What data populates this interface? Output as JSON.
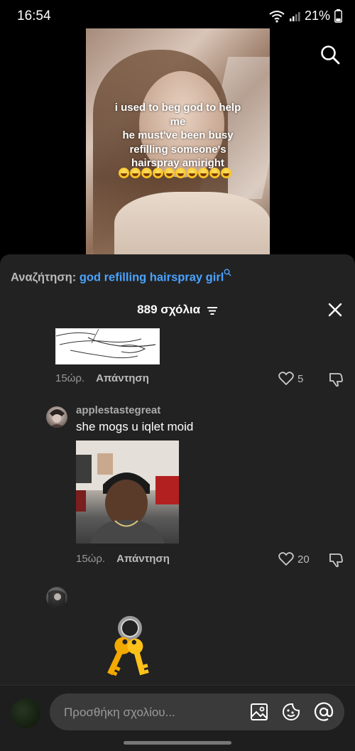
{
  "status": {
    "time": "16:54",
    "battery": "21%"
  },
  "video": {
    "caption": "i used to beg god to help\nme\nhe must've been busy\nrefilling someone's\nhairspray amiright",
    "emoji_count": 10
  },
  "search": {
    "prefix": "Αναζήτηση:",
    "term": "god refilling hairspray girl"
  },
  "comments_header": {
    "count_label": "889 σχόλια"
  },
  "comments": [
    {
      "time": "15ώρ.",
      "reply_label": "Απάντηση",
      "likes": "5"
    },
    {
      "username": "applestastegreat",
      "text": "she mogs u iqlet moid",
      "time": "15ώρ.",
      "reply_label": "Απάντηση",
      "likes": "20"
    }
  ],
  "input": {
    "placeholder": "Προσθήκη σχολίου..."
  },
  "icons": {
    "search": "search-icon",
    "close": "close-icon",
    "filter": "filter-icon",
    "heart": "heart-icon",
    "dislike": "dislike-icon",
    "image": "image-icon",
    "emoji": "emoji-icon",
    "mention": "at-icon",
    "keys": "keys-emoji"
  },
  "colors": {
    "accent_link": "#4aa3ff",
    "sheet_bg": "#222222",
    "input_bg": "#3a3a3a"
  }
}
